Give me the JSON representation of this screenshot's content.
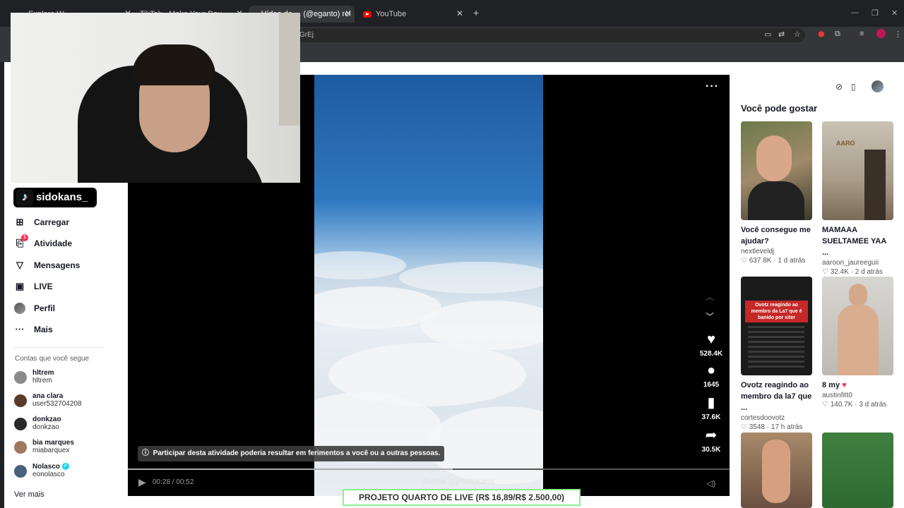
{
  "browser": {
    "tabs": [
      {
        "label": "Explore W",
        "active": false
      },
      {
        "label": "TikTok - Make Your Day",
        "active": false
      },
      {
        "label": "Vídeo de ... (@eganto) rel",
        "active": true
      },
      {
        "label": "YouTube",
        "active": false
      }
    ],
    "address": "GrEj",
    "new_tab": "+",
    "window_controls": [
      "—",
      "❐",
      "✕"
    ]
  },
  "sidebar": {
    "logo_text": "sidokans_",
    "nav": [
      {
        "label": "Carregar",
        "icon": "plus-square-icon"
      },
      {
        "label": "Atividade",
        "icon": "inbox-icon",
        "badge": "1"
      },
      {
        "label": "Mensagens",
        "icon": "send-icon"
      },
      {
        "label": "LIVE",
        "icon": "live-tv-icon"
      },
      {
        "label": "Perfil",
        "icon": "profile-avatar-icon"
      },
      {
        "label": "Mais",
        "icon": "more-icon"
      }
    ],
    "following_title": "Contas que você segue",
    "accounts": [
      {
        "name": "hltrem",
        "handle": "hltrem",
        "color": "#8a8a8a"
      },
      {
        "name": "ana clara",
        "handle": "user532704208",
        "color": "#5a3a2a"
      },
      {
        "name": "donkzao",
        "handle": "donkzao",
        "color": "#2a2a2a"
      },
      {
        "name": "bia marques",
        "handle": "miabarquex",
        "color": "#a07860"
      },
      {
        "name": "Nolasco",
        "handle": "eonolasco",
        "color": "#4a6080",
        "verified": true
      }
    ],
    "see_more": "Ver mais"
  },
  "player": {
    "warning": "Participar desta atividade poderia resultar em ferimentos a você ou a outras pessoas.",
    "time": "00:28 / 00:52",
    "progress": 0.54,
    "likes": "528.4K",
    "comments": "1645",
    "saves": "37.6K",
    "shares": "30.5K"
  },
  "overlay": {
    "livepix": "livepix.gg/sidokans",
    "donation": "PROJETO QUARTO DE LIVE (R$ 16,89/R$ 2.500,00)"
  },
  "recommendations": {
    "title": "Você pode gostar",
    "cards": [
      {
        "title": "Você consegue me ajudar?",
        "author": "nextleveldj",
        "likes": "637.8K",
        "time": "1 d atrás"
      },
      {
        "title": "MAMAAA SUELTAMEE YAA ...",
        "author": "aaroon_jaureeguii",
        "likes": "32.4K",
        "time": "2 d atrás"
      },
      {
        "title": "Ovotz reagindo ao membro da la7 que ...",
        "author": "cortesdoovotz",
        "likes": "3548",
        "time": "17 h atrás",
        "thumb_caption": "Ovotz reagindo ao membro da La7 que é banido por xiter"
      },
      {
        "title": "8 my",
        "author": "austinfitt0",
        "likes": "140.7K",
        "time": "3 d atrás"
      }
    ],
    "thumb_top_text": "AARO"
  }
}
